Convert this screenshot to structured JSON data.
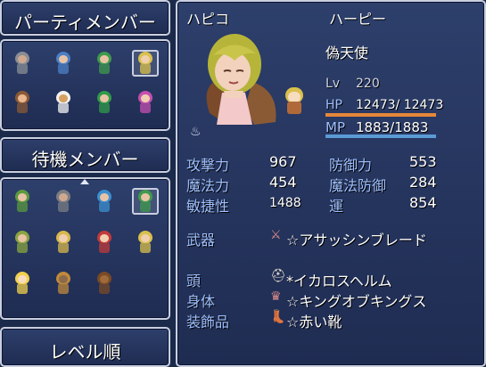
{
  "party_window": {
    "title": "パーティメンバー"
  },
  "reserve_window": {
    "title": "待機メンバー"
  },
  "sort_window": {
    "label": "レベル順"
  },
  "party_members": [
    {
      "hair": "#8a8d93",
      "skin": "#cfa890"
    },
    {
      "hair": "#4c7fc4",
      "skin": "#e9c3a6"
    },
    {
      "hair": "#3f9a4d",
      "skin": "#e9c3a6"
    },
    {
      "hair": "#d9c04c",
      "skin": "#f0cfb0"
    },
    {
      "hair": "#8b5a35",
      "skin": "#e9b890"
    },
    {
      "hair": "#f2f2f2",
      "skin": "#d8a060"
    },
    {
      "hair": "#2f9b4a",
      "skin": "#e9c3a6"
    },
    {
      "hair": "#c44fb0",
      "skin": "#f0cfb0"
    }
  ],
  "reserve_members": [
    {
      "hair": "#5b9a3f",
      "skin": "#e9c3a6"
    },
    {
      "hair": "#7a7d83",
      "skin": "#cfa890"
    },
    {
      "hair": "#3b8fd0",
      "skin": "#e9c3a6"
    },
    {
      "hair": "#3f9a4d",
      "skin": "#e9c3a6"
    },
    {
      "hair": "#8aa53f",
      "skin": "#e9c3a6"
    },
    {
      "hair": "#d9b84c",
      "skin": "#f0cfb0"
    },
    {
      "hair": "#c23a3a",
      "skin": "#f0cfb0"
    },
    {
      "hair": "#d9c04c",
      "skin": "#f0cfb0"
    },
    {
      "hair": "#f2d04c",
      "skin": "#f7dcc0"
    },
    {
      "hair": "#c08a3a",
      "skin": "#8a6a4a"
    },
    {
      "hair": "#7a4a25",
      "skin": "#a06a3a"
    }
  ],
  "status": {
    "name": "ハピコ",
    "class": "ハーピー",
    "nickname": "偽天使",
    "lv_label": "Lv",
    "lv": "220",
    "hp_label": "HP",
    "hp": "12473/ 12473",
    "mp_label": "MP",
    "mp": "1883/1883",
    "hp_ratio": 1.0,
    "mp_ratio": 1.0
  },
  "params": {
    "atk_label": "攻撃力",
    "atk": "967",
    "mat_label": "魔法力",
    "mat": "454",
    "agi_label": "敏捷性",
    "agi": "1488",
    "def_label": "防御力",
    "def": "553",
    "mdf_label": "魔法防御",
    "mdf": "284",
    "luk_label": "運",
    "luk": "854"
  },
  "equips": {
    "weapon_label": "武器",
    "weapon": "☆アサッシンブレード",
    "head_label": "頭",
    "head": "*イカロスヘルム",
    "body_label": "身体",
    "body": "☆キングオブキングス",
    "acc_label": "装飾品",
    "acc": "☆赤い靴"
  },
  "colors": {
    "hp_bar": "#e6873a",
    "mp_bar": "#5b9bd5",
    "label": "#9fc0ff"
  }
}
